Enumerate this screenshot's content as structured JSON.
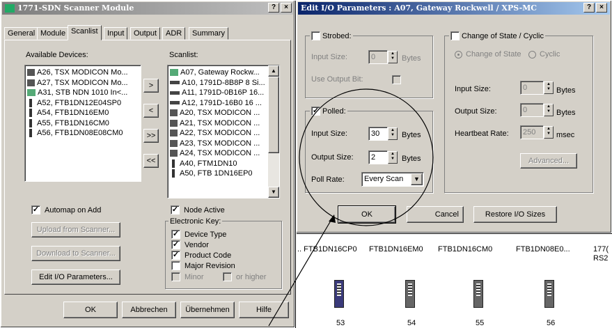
{
  "left_window": {
    "title": "1771-SDN Scanner Module",
    "help": "?",
    "close": "×",
    "tabs": [
      "General",
      "Module",
      "Scanlist",
      "Input",
      "Output",
      "ADR",
      "Summary"
    ],
    "available_label": "Available Devices:",
    "scanlist_label": "Scanlist:",
    "available": [
      "A26, TSX MODICON Mo...",
      "A27, TSX MODICON Mo...",
      "A31, STB NDN 1010 In<...",
      "A52, FTB1DN12E04SP0",
      "A54, FTB1DN16EM0",
      "A55, FTB1DN16CM0",
      "A56, FTB1DN08E08CM0"
    ],
    "scanlist": [
      "A07, Gateway Rockw...",
      "A10, 1791D-8B8P 8 Si...",
      "A11, 1791D-0B16P 16...",
      "A12, 1791D-16B0 16 ...",
      "A20, TSX MODICON ...",
      "A21, TSX MODICON ...",
      "A22, TSX MODICON ...",
      "A23, TSX MODICON ...",
      "A24, TSX MODICON ...",
      "A40, FTM1DN10",
      "A50, FTB 1DN16EP0"
    ],
    "move_buttons": [
      ">",
      "<",
      ">>",
      "<<"
    ],
    "automap": "Automap on Add",
    "upload": "Upload from Scanner...",
    "download": "Download to Scanner...",
    "edit_io": "Edit I/O Parameters...",
    "node_active": "Node Active",
    "elec_key": "Electronic Key:",
    "device_type": "Device Type",
    "vendor": "Vendor",
    "product_code": "Product Code",
    "major_revision": "Major Revision",
    "minor": "Minor",
    "or_higher": "or higher",
    "ok": "OK",
    "cancel": "Abbrechen",
    "apply": "Übernehmen",
    "help_btn": "Hilfe"
  },
  "right_window": {
    "title": "Edit I/O Parameters : A07, Gateway Rockwell / XPS-MC",
    "help": "?",
    "close": "×",
    "strobed": "Strobed:",
    "input_size": "Input Size:",
    "output_size": "Output Size:",
    "bytes": "Bytes",
    "use_output_bit": "Use Output Bit:",
    "strobed_input_value": "0",
    "polled": "Polled:",
    "polled_input_value": "30",
    "polled_output_value": "2",
    "poll_rate_label": "Poll Rate:",
    "poll_rate_value": "Every Scan",
    "cos": "Change of State / Cyclic",
    "change_of_state": "Change of State",
    "cyclic": "Cyclic",
    "cos_input_value": "0",
    "cos_output_value": "0",
    "heartbeat": "Heartbeat Rate:",
    "heartbeat_value": "250",
    "msec": "msec",
    "advanced": "Advanced...",
    "ok": "OK",
    "cancel": "Cancel",
    "restore": "Restore I/O Sizes"
  },
  "background": {
    "devices": [
      ".. FTB1DN16CP0",
      "FTB1DN16EM0",
      "FTB1DN16CM0",
      "FTB1DN08E0...",
      "177(",
      "RS2"
    ],
    "node_numbers": [
      "53",
      "54",
      "55",
      "56"
    ]
  }
}
